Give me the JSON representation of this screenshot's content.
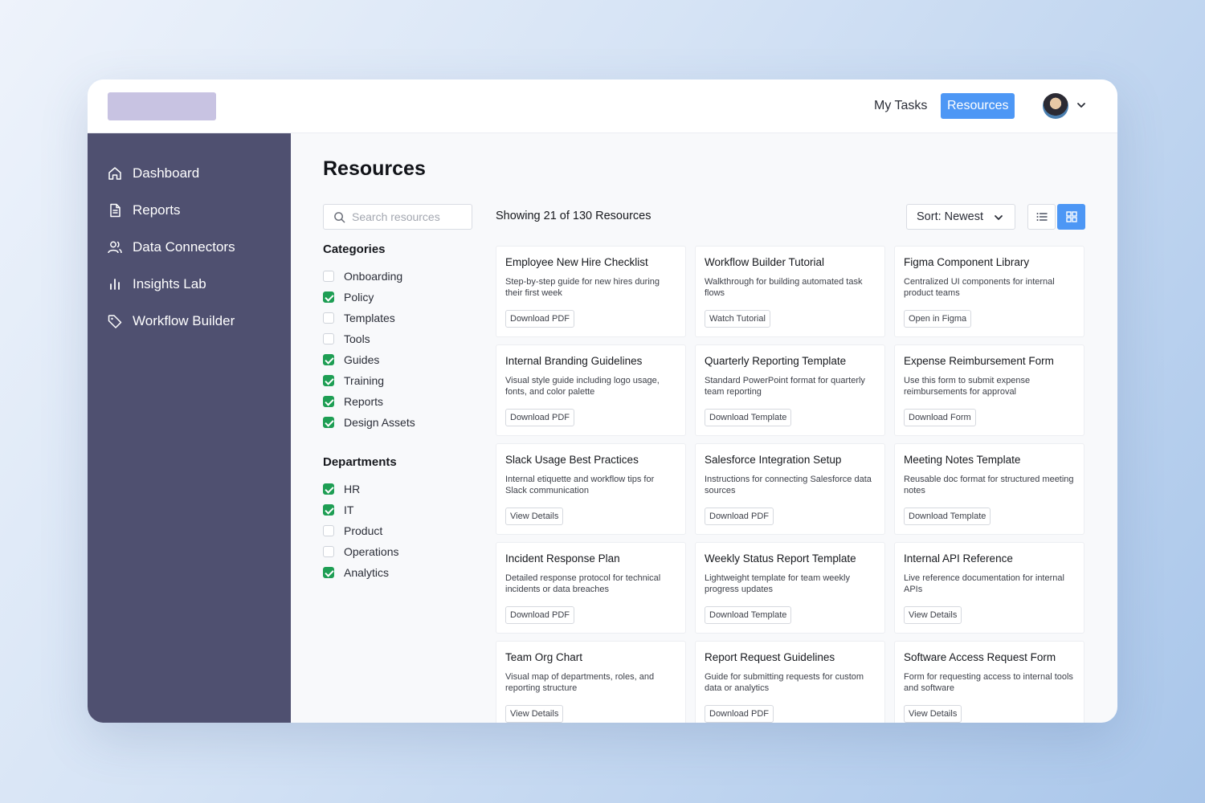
{
  "header": {
    "nav": [
      {
        "label": "My Tasks"
      },
      {
        "label": "Resources",
        "active": true
      }
    ],
    "accent_color": "#4d97f5"
  },
  "sidebar": {
    "background": "#4f5070",
    "items": [
      {
        "label": "Dashboard",
        "icon": "home-icon"
      },
      {
        "label": "Reports",
        "icon": "document-icon"
      },
      {
        "label": "Data Connectors",
        "icon": "users-icon"
      },
      {
        "label": "Insights Lab",
        "icon": "bar-chart-icon"
      },
      {
        "label": "Workflow Builder",
        "icon": "tag-icon"
      }
    ]
  },
  "main": {
    "title": "Resources",
    "search": {
      "placeholder": "Search resources",
      "value": ""
    },
    "showing_text": "Showing 21 of 130 Resources",
    "sort_label": "Sort: Newest",
    "view_mode": "grid"
  },
  "filters": {
    "categories_heading": "Categories",
    "categories": [
      {
        "label": "Onboarding",
        "checked": false
      },
      {
        "label": "Policy",
        "checked": true
      },
      {
        "label": "Templates",
        "checked": false
      },
      {
        "label": "Tools",
        "checked": false
      },
      {
        "label": "Guides",
        "checked": true
      },
      {
        "label": "Training",
        "checked": true
      },
      {
        "label": "Reports",
        "checked": true
      },
      {
        "label": "Design Assets",
        "checked": true
      }
    ],
    "departments_heading": "Departments",
    "departments": [
      {
        "label": "HR",
        "checked": true
      },
      {
        "label": "IT",
        "checked": true
      },
      {
        "label": "Product",
        "checked": false
      },
      {
        "label": "Operations",
        "checked": false
      },
      {
        "label": "Analytics",
        "checked": true
      }
    ],
    "checkbox_color": "#1e9e54"
  },
  "cards": [
    {
      "title": "Employee New Hire Checklist",
      "desc": "Step-by-step guide for new hires during their first week",
      "action": "Download PDF"
    },
    {
      "title": "Workflow Builder Tutorial",
      "desc": "Walkthrough for building automated task flows",
      "action": "Watch Tutorial"
    },
    {
      "title": "Figma Component Library",
      "desc": "Centralized UI components for internal product teams",
      "action": "Open in Figma"
    },
    {
      "title": "Internal Branding Guidelines",
      "desc": "Visual style guide including logo usage, fonts, and color palette",
      "action": "Download PDF"
    },
    {
      "title": "Quarterly Reporting Template",
      "desc": "Standard PowerPoint format for quarterly team reporting",
      "action": "Download Template"
    },
    {
      "title": "Expense Reimbursement Form",
      "desc": "Use this form to submit expense reimbursements for approval",
      "action": "Download Form"
    },
    {
      "title": "Slack Usage Best Practices",
      "desc": "Internal etiquette and workflow tips for Slack communication",
      "action": "View Details"
    },
    {
      "title": "Salesforce Integration Setup",
      "desc": "Instructions for connecting Salesforce data sources",
      "action": "Download PDF"
    },
    {
      "title": "Meeting Notes Template",
      "desc": "Reusable doc format for structured meeting notes",
      "action": "Download Template"
    },
    {
      "title": "Incident Response Plan",
      "desc": "Detailed response protocol for technical incidents or data breaches",
      "action": "Download PDF"
    },
    {
      "title": "Weekly Status Report Template",
      "desc": "Lightweight template for team weekly progress updates",
      "action": "Download Template"
    },
    {
      "title": "Internal API Reference",
      "desc": "Live reference documentation for internal APIs",
      "action": "View Details"
    },
    {
      "title": "Team Org Chart",
      "desc": "Visual map of departments, roles, and reporting structure",
      "action": "View Details"
    },
    {
      "title": "Report Request Guidelines",
      "desc": "Guide for submitting requests for custom data or analytics",
      "action": "Download PDF"
    },
    {
      "title": "Software Access Request Form",
      "desc": "Form for requesting access to internal tools and software",
      "action": "View Details"
    }
  ]
}
